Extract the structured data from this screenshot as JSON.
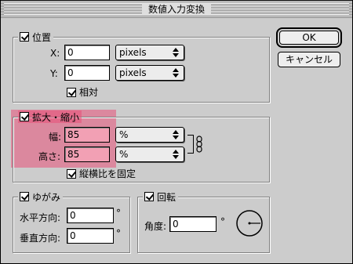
{
  "dialog": {
    "title": "数値入力変換"
  },
  "buttons": {
    "ok": "OK",
    "cancel": "キャンセル"
  },
  "position_group": {
    "label": "位置",
    "checked": true,
    "x_label": "X:",
    "x_value": "0",
    "x_unit": "pixels",
    "y_label": "Y:",
    "y_value": "0",
    "y_unit": "pixels",
    "relative_label": "相対",
    "relative_checked": true
  },
  "scale_group": {
    "label": "拡大・縮小",
    "checked": true,
    "width_label": "幅:",
    "width_value": "85",
    "width_unit": "%",
    "height_label": "高さ:",
    "height_value": "85",
    "height_unit": "%",
    "constrain_label": "縦横比を固定",
    "constrain_checked": true
  },
  "skew_group": {
    "label": "ゆがみ",
    "checked": true,
    "horizontal_label": "水平方向:",
    "horizontal_value": "0",
    "vertical_label": "垂直方向:",
    "vertical_value": "0",
    "degree_symbol": "°"
  },
  "rotate_group": {
    "label": "回転",
    "checked": true,
    "angle_label": "角度:",
    "angle_value": "0",
    "degree_symbol": "°"
  },
  "colors": {
    "highlight": "#e85078",
    "dialog_bg": "#cccccc"
  }
}
